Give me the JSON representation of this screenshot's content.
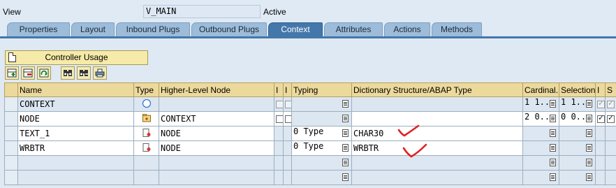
{
  "header": {
    "view_label": "View",
    "view_value": "V_MAIN",
    "status": "Active"
  },
  "tabs": [
    "Properties",
    "Layout",
    "Inbound Plugs",
    "Outbound Plugs",
    "Context",
    "Attributes",
    "Actions",
    "Methods"
  ],
  "active_tab": "Context",
  "controller_usage_label": "Controller Usage",
  "toolbar_icons": [
    "insert-row-icon",
    "delete-row-icon",
    "refresh-icon",
    "find-icon",
    "find-next-icon",
    "print-icon"
  ],
  "table": {
    "columns": [
      "Name",
      "Type",
      "Higher-Level Node",
      "I",
      "I",
      "Typing",
      "Dictionary Structure/ABAP Type",
      "Cardinal...",
      "Selection",
      "I",
      "S"
    ],
    "rows": [
      {
        "name": "CONTEXT",
        "type_icon": "root-node-icon",
        "higher": "",
        "typing": "",
        "dict": "",
        "card": "1 1...",
        "selection": "1 1...",
        "i": "checked-disabled",
        "s": "checked-disabled"
      },
      {
        "name": "NODE",
        "type_icon": "node-folder-icon",
        "higher": "CONTEXT",
        "typing": "",
        "dict": "",
        "card": "2 0...",
        "selection": "0 0...",
        "i": "checked",
        "s": "checked"
      },
      {
        "name": "TEXT_1",
        "type_icon": "attribute-icon",
        "higher": "NODE",
        "typing": "0 Type",
        "dict": "CHAR30",
        "card": "",
        "selection": "",
        "i": "",
        "s": ""
      },
      {
        "name": "WRBTR",
        "type_icon": "attribute-icon",
        "higher": "NODE",
        "typing": "0 Type",
        "dict": "WRBTR",
        "card": "",
        "selection": "",
        "i": "",
        "s": ""
      },
      {
        "name": "",
        "type_icon": "",
        "higher": "",
        "typing": "",
        "dict": "",
        "card": "",
        "selection": "",
        "i": "",
        "s": ""
      },
      {
        "name": "",
        "type_icon": "",
        "higher": "",
        "typing": "",
        "dict": "",
        "card": "",
        "selection": "",
        "i": "",
        "s": ""
      }
    ]
  },
  "annotation_color": "#e02020"
}
